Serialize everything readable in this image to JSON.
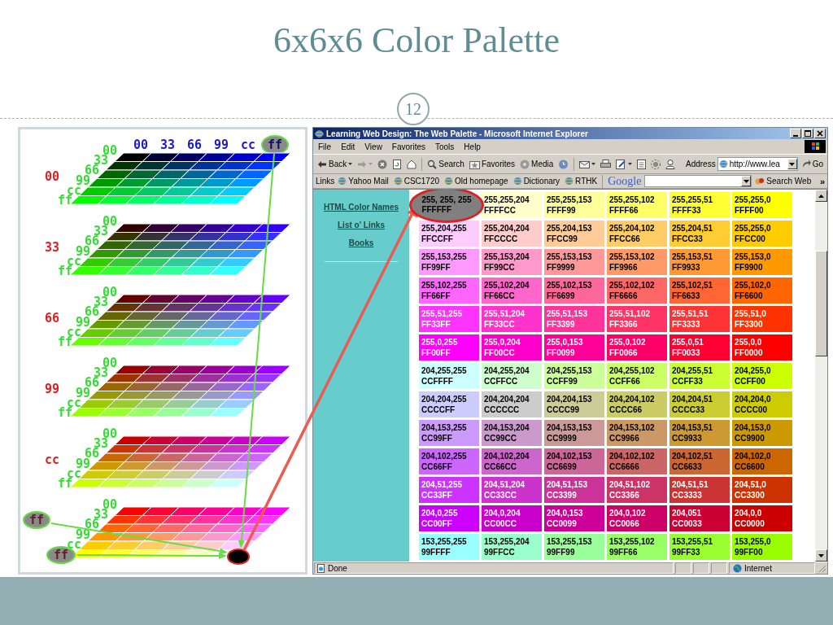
{
  "slide": {
    "title": "6x6x6 Color Palette",
    "number": "12"
  },
  "figure": {
    "column_labels": [
      {
        "text": "00",
        "circled": false
      },
      {
        "text": "33",
        "circled": false
      },
      {
        "text": "66",
        "circled": false
      },
      {
        "text": "99",
        "circled": false
      },
      {
        "text": "cc",
        "circled": false
      },
      {
        "text": "ff",
        "circled": true
      }
    ],
    "layers": [
      {
        "layer_label": {
          "text": "00",
          "circled": false
        },
        "row_labels": [
          {
            "text": "00",
            "circled": false
          },
          {
            "text": "33",
            "circled": false
          },
          {
            "text": "66",
            "circled": false
          },
          {
            "text": "99",
            "circled": false
          },
          {
            "text": "cc",
            "circled": false
          },
          {
            "text": "ff",
            "circled": false
          }
        ]
      },
      {
        "layer_label": {
          "text": "33",
          "circled": false
        },
        "row_labels": [
          {
            "text": "00",
            "circled": false
          },
          {
            "text": "33",
            "circled": false
          },
          {
            "text": "66",
            "circled": false
          },
          {
            "text": "99",
            "circled": false
          },
          {
            "text": "cc",
            "circled": false
          },
          {
            "text": "ff",
            "circled": false
          }
        ]
      },
      {
        "layer_label": {
          "text": "66",
          "circled": false
        },
        "row_labels": [
          {
            "text": "00",
            "circled": false
          },
          {
            "text": "33",
            "circled": false
          },
          {
            "text": "66",
            "circled": false
          },
          {
            "text": "99",
            "circled": false
          },
          {
            "text": "cc",
            "circled": false
          },
          {
            "text": "ff",
            "circled": false
          }
        ]
      },
      {
        "layer_label": {
          "text": "99",
          "circled": false
        },
        "row_labels": [
          {
            "text": "00",
            "circled": false
          },
          {
            "text": "33",
            "circled": false
          },
          {
            "text": "66",
            "circled": false
          },
          {
            "text": "99",
            "circled": false
          },
          {
            "text": "cc",
            "circled": false
          },
          {
            "text": "ff",
            "circled": false
          }
        ]
      },
      {
        "layer_label": {
          "text": "cc",
          "circled": false
        },
        "row_labels": [
          {
            "text": "00",
            "circled": false
          },
          {
            "text": "33",
            "circled": false
          },
          {
            "text": "66",
            "circled": false
          },
          {
            "text": "99",
            "circled": false
          },
          {
            "text": "cc",
            "circled": false
          },
          {
            "text": "ff",
            "circled": false
          }
        ]
      },
      {
        "layer_label": {
          "text": "ff",
          "circled": true
        },
        "row_labels": [
          {
            "text": "00",
            "circled": false
          },
          {
            "text": "33",
            "circled": false
          },
          {
            "text": "66",
            "circled": false
          },
          {
            "text": "99",
            "circled": false
          },
          {
            "text": "cc",
            "circled": false
          },
          {
            "text": "ff",
            "circled": true
          }
        ]
      }
    ]
  },
  "browser": {
    "title": "Learning Web Design: The Web Palette - Microsoft Internet Explorer",
    "menu": [
      "File",
      "Edit",
      "View",
      "Favorites",
      "Tools",
      "Help"
    ],
    "toolbar": {
      "back": "Back",
      "search": "Search",
      "favorites": "Favorites",
      "media": "Media",
      "address_label": "Address",
      "address": "http://www.lea",
      "go": "Go"
    },
    "links_bar": {
      "label": "Links",
      "links": [
        "Yahoo Mail",
        "CSC1720",
        "Old homepage",
        "Dictionary",
        "RTHK"
      ],
      "google": "Google",
      "search_web": "Search Web",
      "more": "»"
    },
    "sidebar": [
      "HTML Color Names",
      "List o' Links",
      "Books"
    ],
    "rows": [
      {
        "cells": [
          {
            "rgb": "255, 255, 255",
            "hex": "FFFFFF",
            "color": "#808080",
            "circled": true
          },
          {
            "rgb": "255,255,204",
            "hex": "FFFFCC",
            "color": "#ffffcc",
            "circled": false
          },
          {
            "rgb": "255,255,153",
            "hex": "FFFF99",
            "color": "#ffff99",
            "circled": false
          },
          {
            "rgb": "255,255,102",
            "hex": "FFFF66",
            "color": "#ffff66",
            "circled": false
          },
          {
            "rgb": "255,255,51",
            "hex": "FFFF33",
            "color": "#ffff33",
            "circled": false
          },
          {
            "rgb": "255,255,0",
            "hex": "FFFF00",
            "color": "#ffff00",
            "circled": false
          }
        ]
      },
      {
        "cells": [
          {
            "rgb": "255,204,255",
            "hex": "FFCCFF",
            "color": "#ffccff",
            "circled": false
          },
          {
            "rgb": "255,204,204",
            "hex": "FFCCCC",
            "color": "#ffcccc",
            "circled": false
          },
          {
            "rgb": "255,204,153",
            "hex": "FFCC99",
            "color": "#ffcc99",
            "circled": false
          },
          {
            "rgb": "255,204,102",
            "hex": "FFCC66",
            "color": "#ffcc66",
            "circled": false
          },
          {
            "rgb": "255,204,51",
            "hex": "FFCC33",
            "color": "#ffcc33",
            "circled": false
          },
          {
            "rgb": "255,255,0",
            "hex": "FFCC00",
            "color": "#ffcc00",
            "circled": false
          }
        ]
      },
      {
        "cells": [
          {
            "rgb": "255,153,255",
            "hex": "FF99FF",
            "color": "#ff99ff",
            "circled": false
          },
          {
            "rgb": "255,153,204",
            "hex": "FF99CC",
            "color": "#ff99cc",
            "circled": false
          },
          {
            "rgb": "255,153,153",
            "hex": "FF9999",
            "color": "#ff9999",
            "circled": false
          },
          {
            "rgb": "255,153,102",
            "hex": "FF9966",
            "color": "#ff9966",
            "circled": false
          },
          {
            "rgb": "255,153,51",
            "hex": "FF9933",
            "color": "#ff9933",
            "circled": false
          },
          {
            "rgb": "255,153,0",
            "hex": "FF9900",
            "color": "#ff9900",
            "circled": false
          }
        ]
      },
      {
        "cells": [
          {
            "rgb": "255,102,255",
            "hex": "FF66FF",
            "color": "#ff66ff",
            "circled": false
          },
          {
            "rgb": "255,102,204",
            "hex": "FF66CC",
            "color": "#ff66cc",
            "circled": false
          },
          {
            "rgb": "255,102,153",
            "hex": "FF6699",
            "color": "#ff6699",
            "circled": false
          },
          {
            "rgb": "255,102,102",
            "hex": "FF6666",
            "color": "#ff6666",
            "circled": false
          },
          {
            "rgb": "255,102,51",
            "hex": "FF6633",
            "color": "#ff6633",
            "circled": false
          },
          {
            "rgb": "255,102,0",
            "hex": "FF6600",
            "color": "#ff6600",
            "circled": false
          }
        ]
      },
      {
        "cells": [
          {
            "rgb": "255,51,255",
            "hex": "FF33FF",
            "color": "#ff33ff",
            "circled": false
          },
          {
            "rgb": "255,51,204",
            "hex": "FF33CC",
            "color": "#ff33cc",
            "circled": false
          },
          {
            "rgb": "255,51,153",
            "hex": "FF3399",
            "color": "#ff3399",
            "circled": false
          },
          {
            "rgb": "255,51,102",
            "hex": "FF3366",
            "color": "#ff3366",
            "circled": false
          },
          {
            "rgb": "255,51,51",
            "hex": "FF3333",
            "color": "#ff3333",
            "circled": false
          },
          {
            "rgb": "255,51,0",
            "hex": "FF3300",
            "color": "#ff3300",
            "circled": false
          }
        ]
      },
      {
        "cells": [
          {
            "rgb": "255,0,255",
            "hex": "FF00FF",
            "color": "#ff00ff",
            "circled": false
          },
          {
            "rgb": "255,0,204",
            "hex": "FF00CC",
            "color": "#ff00cc",
            "circled": false
          },
          {
            "rgb": "255,0,153",
            "hex": "FF0099",
            "color": "#ff0099",
            "circled": false
          },
          {
            "rgb": "255,0,102",
            "hex": "FF0066",
            "color": "#ff0066",
            "circled": false
          },
          {
            "rgb": "255,0,51",
            "hex": "FF0033",
            "color": "#ff0033",
            "circled": false
          },
          {
            "rgb": "255,0,0",
            "hex": "FF0000",
            "color": "#ff0000",
            "circled": false
          }
        ]
      },
      {
        "cells": [
          {
            "rgb": "204,255,255",
            "hex": "CCFFFF",
            "color": "#ccffff",
            "circled": false
          },
          {
            "rgb": "204,255,204",
            "hex": "CCFFCC",
            "color": "#ccffcc",
            "circled": false
          },
          {
            "rgb": "204,255,153",
            "hex": "CCFF99",
            "color": "#ccff99",
            "circled": false
          },
          {
            "rgb": "204,255,102",
            "hex": "CCFF66",
            "color": "#ccff66",
            "circled": false
          },
          {
            "rgb": "204,255,51",
            "hex": "CCFF33",
            "color": "#ccff33",
            "circled": false
          },
          {
            "rgb": "204,255,0",
            "hex": "CCFF00",
            "color": "#ccff00",
            "circled": false
          }
        ]
      },
      {
        "cells": [
          {
            "rgb": "204,204,255",
            "hex": "CCCCFF",
            "color": "#ccccff",
            "circled": false
          },
          {
            "rgb": "204,204,204",
            "hex": "CCCCCC",
            "color": "#cccccc",
            "circled": false
          },
          {
            "rgb": "204,204,153",
            "hex": "CCCC99",
            "color": "#cccc99",
            "circled": false
          },
          {
            "rgb": "204,204,102",
            "hex": "CCCC66",
            "color": "#cccc66",
            "circled": false
          },
          {
            "rgb": "204,204,51",
            "hex": "CCCC33",
            "color": "#cccc33",
            "circled": false
          },
          {
            "rgb": "204,204,0",
            "hex": "CCCC00",
            "color": "#cccc00",
            "circled": false
          }
        ]
      },
      {
        "cells": [
          {
            "rgb": "204,153,255",
            "hex": "CC99FF",
            "color": "#cc99ff",
            "circled": false
          },
          {
            "rgb": "204,153,204",
            "hex": "CC99CC",
            "color": "#cc99cc",
            "circled": false
          },
          {
            "rgb": "204,153,153",
            "hex": "CC9999",
            "color": "#cc9999",
            "circled": false
          },
          {
            "rgb": "204,153,102",
            "hex": "CC9966",
            "color": "#cc9966",
            "circled": false
          },
          {
            "rgb": "204,153,51",
            "hex": "CC9933",
            "color": "#cc9933",
            "circled": false
          },
          {
            "rgb": "204,153,0",
            "hex": "CC9900",
            "color": "#cc9900",
            "circled": false
          }
        ]
      },
      {
        "cells": [
          {
            "rgb": "204,102,255",
            "hex": "CC66FF",
            "color": "#cc66ff",
            "circled": false
          },
          {
            "rgb": "204,102,204",
            "hex": "CC66CC",
            "color": "#cc66cc",
            "circled": false
          },
          {
            "rgb": "204,102,153",
            "hex": "CC6699",
            "color": "#cc6699",
            "circled": false
          },
          {
            "rgb": "204,102,102",
            "hex": "CC6666",
            "color": "#cc6666",
            "circled": false
          },
          {
            "rgb": "204,102,51",
            "hex": "CC6633",
            "color": "#cc6633",
            "circled": false
          },
          {
            "rgb": "204,102,0",
            "hex": "CC6600",
            "color": "#cc6600",
            "circled": false
          }
        ]
      },
      {
        "cells": [
          {
            "rgb": "204,51,255",
            "hex": "CC33FF",
            "color": "#cc33ff",
            "circled": false
          },
          {
            "rgb": "204,51,204",
            "hex": "CC33CC",
            "color": "#cc33cc",
            "circled": false
          },
          {
            "rgb": "204,51,153",
            "hex": "CC3399",
            "color": "#cc3399",
            "circled": false
          },
          {
            "rgb": "204,51,102",
            "hex": "CC3366",
            "color": "#cc3366",
            "circled": false
          },
          {
            "rgb": "204,51,51",
            "hex": "CC3333",
            "color": "#cc3333",
            "circled": false
          },
          {
            "rgb": "204,51,0",
            "hex": "CC3300",
            "color": "#cc3300",
            "circled": false
          }
        ]
      },
      {
        "cells": [
          {
            "rgb": "204,0,255",
            "hex": "CC00FF",
            "color": "#cc00ff",
            "circled": false
          },
          {
            "rgb": "204,0,204",
            "hex": "CC00CC",
            "color": "#cc00cc",
            "circled": false
          },
          {
            "rgb": "204,0,153",
            "hex": "CC0099",
            "color": "#cc0099",
            "circled": false
          },
          {
            "rgb": "204,0,102",
            "hex": "CC0066",
            "color": "#cc0066",
            "circled": false
          },
          {
            "rgb": "204,051",
            "hex": "CC0033",
            "color": "#cc0033",
            "circled": false
          },
          {
            "rgb": "204,0,0",
            "hex": "CC0000",
            "color": "#cc0000",
            "circled": false
          }
        ]
      },
      {
        "cells": [
          {
            "rgb": "153,255,255",
            "hex": "99FFFF",
            "color": "#99ffff",
            "circled": false
          },
          {
            "rgb": "153,255,204",
            "hex": "99FFCC",
            "color": "#99ffcc",
            "circled": false
          },
          {
            "rgb": "153,255,153",
            "hex": "99FF99",
            "color": "#99ff99",
            "circled": false
          },
          {
            "rgb": "153,255,102",
            "hex": "99FF66",
            "color": "#99ff66",
            "circled": false
          },
          {
            "rgb": "153,255,51",
            "hex": "99FF33",
            "color": "#99ff33",
            "circled": false
          },
          {
            "rgb": "153,255,0",
            "hex": "99FF00",
            "color": "#99ff00",
            "circled": false
          }
        ]
      }
    ],
    "status": {
      "text": "Done",
      "zone": "Internet"
    }
  }
}
